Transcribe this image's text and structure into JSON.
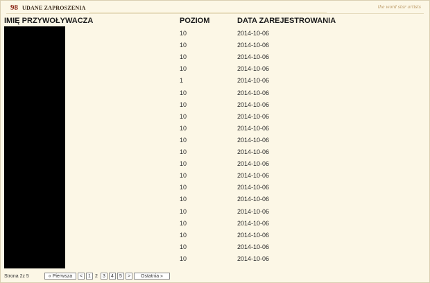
{
  "header": {
    "count": "98",
    "title": "UDANE ZAPROSZENIA",
    "decoration": "the word star artists"
  },
  "table": {
    "columns": [
      "IMIĘ PRZYWOŁYWACZA",
      "POZIOM",
      "DATA ZAREJESTROWANIA"
    ],
    "rows": [
      {
        "level": "10",
        "date": "2014-10-06"
      },
      {
        "level": "10",
        "date": "2014-10-06"
      },
      {
        "level": "10",
        "date": "2014-10-06"
      },
      {
        "level": "10",
        "date": "2014-10-06"
      },
      {
        "level": "1",
        "date": "2014-10-06"
      },
      {
        "level": "10",
        "date": "2014-10-06"
      },
      {
        "level": "10",
        "date": "2014-10-06"
      },
      {
        "level": "10",
        "date": "2014-10-06"
      },
      {
        "level": "10",
        "date": "2014-10-06"
      },
      {
        "level": "10",
        "date": "2014-10-06"
      },
      {
        "level": "10",
        "date": "2014-10-06"
      },
      {
        "level": "10",
        "date": "2014-10-06"
      },
      {
        "level": "10",
        "date": "2014-10-06"
      },
      {
        "level": "10",
        "date": "2014-10-06"
      },
      {
        "level": "10",
        "date": "2014-10-06"
      },
      {
        "level": "10",
        "date": "2014-10-06"
      },
      {
        "level": "10",
        "date": "2014-10-06"
      },
      {
        "level": "10",
        "date": "2014-10-06"
      },
      {
        "level": "10",
        "date": "2014-10-06"
      },
      {
        "level": "10",
        "date": "2014-10-06"
      }
    ]
  },
  "pagination": {
    "label": "Strona 2z 5",
    "first": "« Pierwsza",
    "prev": "<",
    "pages": [
      "1",
      "2",
      "3",
      "4",
      "5"
    ],
    "current": "2",
    "next": ">",
    "last": "Ostatnia »"
  }
}
